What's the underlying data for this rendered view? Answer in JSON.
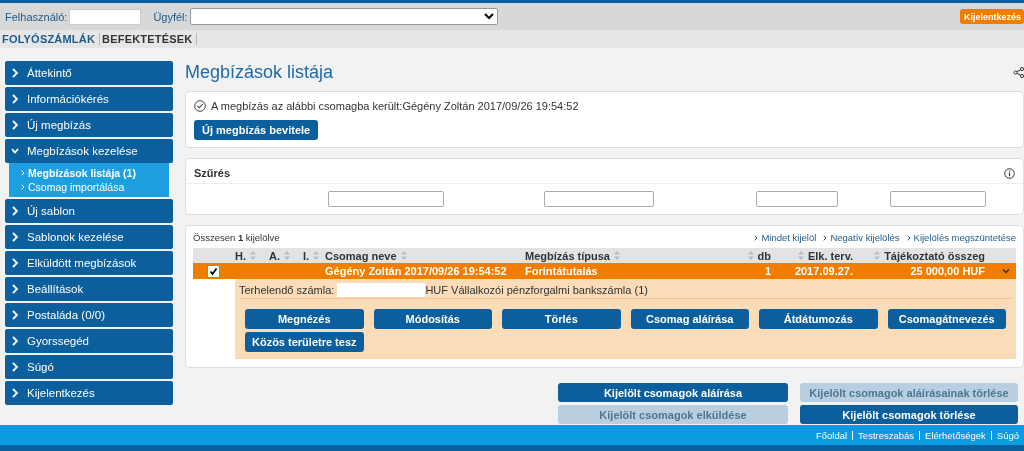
{
  "header": {
    "user_label": "Felhasználó:",
    "client_label": "Ügyfél:",
    "logout": "Kijelentkezés"
  },
  "tabs": [
    {
      "label": "FOLYÓSZÁMLÁK",
      "selected": true
    },
    {
      "label": "BEFEKTETÉSEK",
      "selected": false
    }
  ],
  "sidebar": {
    "items": [
      {
        "label": "Áttekintő",
        "expanded": false
      },
      {
        "label": "Információkérés",
        "expanded": false
      },
      {
        "label": "Új megbízás",
        "expanded": false
      },
      {
        "label": "Megbízások kezelése",
        "expanded": true,
        "children": [
          {
            "label": "Megbízások listája (1)",
            "selected": true
          },
          {
            "label": "Csomag importálása",
            "selected": false
          }
        ]
      },
      {
        "label": "Új sablon",
        "expanded": false
      },
      {
        "label": "Sablonok kezelése",
        "expanded": false
      },
      {
        "label": "Elküldött megbízások",
        "expanded": false
      },
      {
        "label": "Beállítások",
        "expanded": false
      },
      {
        "label": "Postaláda (0/0)",
        "expanded": false
      },
      {
        "label": "Gyorssegéd",
        "expanded": false
      },
      {
        "label": "Súgó",
        "expanded": false
      },
      {
        "label": "Kijelentkezés",
        "expanded": false
      }
    ]
  },
  "page_title": "Megbízások listája",
  "notice": {
    "text": "A megbízás az alábbi csomagba került:Gégény Zoltán 2017/09/26 19:54:52",
    "button": "Új megbízás bevitele"
  },
  "filter": {
    "title": "Szűrés",
    "fields": [
      {
        "kind": "text"
      },
      {
        "kind": "text"
      },
      {
        "kind": "text"
      },
      {
        "kind": "text"
      }
    ]
  },
  "table": {
    "summary": "Összesen **1** kijelölve",
    "links": [
      "Mindet kijelöl",
      "Negatív kijelölés",
      "Kijelölés megszüntetése"
    ],
    "columns": [
      "H.",
      "A.",
      "I.",
      "Csomag neve",
      "Megbízás típusa",
      "db",
      "Elk. terv.",
      "Tájékoztató összeg"
    ],
    "rows": [
      {
        "checked": true,
        "expanded": true,
        "cells": {
          "package_name": "Gégény Zoltán 2017/09/26 19:54:52",
          "order_type": "Forintátutalás",
          "count": "1",
          "planned_date": "2017.09.27.",
          "amount": "25 000,00 HUF"
        },
        "detail": {
          "account_label": "Terhelendő számla:",
          "account_name": "HUF Vállalkozói pénzforgalmi bankszámla (1)",
          "actions": [
            "Megnézés",
            "Módosítás",
            "Törlés",
            "Csomag aláírása",
            "Átdátumozás",
            "Csomagátnevezés",
            "Közös területre tesz"
          ]
        }
      }
    ]
  },
  "bulk_actions": [
    {
      "label": "Kijelölt csomagok aláírása",
      "disabled": false
    },
    {
      "label": "Kijelölt csomagok aláírásainak törlése",
      "disabled": true
    },
    {
      "label": "Kijelölt csomagok elküldése",
      "disabled": true
    },
    {
      "label": "Kijelölt csomagok törlése",
      "disabled": false
    }
  ],
  "footer": {
    "links": [
      "Főoldal",
      "Testreszabás",
      "Elérhetőségek",
      "Súgó"
    ]
  }
}
